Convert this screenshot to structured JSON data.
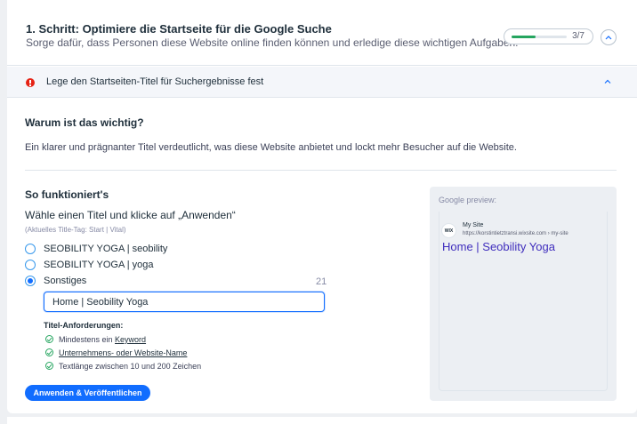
{
  "step": {
    "title": "1. Schritt: Optimiere die Startseite für die Google Suche",
    "description": "Sorge dafür, dass Personen diese Website online finden können und erledige diese wichtigen Aufgaben.",
    "progress_text": "3/7",
    "progress_fraction": 0.43
  },
  "task": {
    "label": "Lege den Startseiten-Titel für Suchergebnisse fest",
    "status_color": "#e62214"
  },
  "why": {
    "title": "Warum ist das wichtig?",
    "text": "Ein klarer und prägnanter Titel verdeutlicht, was diese Website anbietet und lockt mehr Besucher auf die Website."
  },
  "how": {
    "title": "So funktioniert's",
    "choose_title": "Wähle einen Titel und klicke auf „Anwenden“",
    "current_tag": "(Aktuelles Title-Tag: Start | Vital)",
    "options": [
      {
        "label": "SEOBILITY YOGA | seobility",
        "selected": false
      },
      {
        "label": "SEOBILITY YOGA | yoga",
        "selected": false
      },
      {
        "label": "Sonstiges",
        "selected": true
      }
    ],
    "char_count": "21",
    "input_value": "Home | Seobility Yoga",
    "requirements_title": "Titel-Anforderungen:",
    "requirements": [
      {
        "prefix": "Mindestens ein ",
        "link": "Keyword",
        "suffix": ""
      },
      {
        "prefix": "",
        "link": "Unternehmens- oder Website-Name",
        "suffix": ""
      },
      {
        "prefix": "Textlänge zwischen 10 und 200 Zeichen",
        "link": "",
        "suffix": ""
      }
    ],
    "apply_label": "Anwenden & Veröffentlichen"
  },
  "preview": {
    "label": "Google preview:",
    "logo_text": "WIX",
    "site_name": "My Site",
    "site_url": "https://korstintietztransi.wixsite.com › my-site",
    "result_title": "Home | Seobility Yoga"
  },
  "colors": {
    "accent": "#116dff",
    "success": "#25a55f",
    "error": "#e62214",
    "link_title": "#3f2dbd"
  },
  "icons": {
    "collapse": "chevron-up-icon",
    "task_status": "alert-circle-icon",
    "requirement": "check-circle-icon"
  }
}
